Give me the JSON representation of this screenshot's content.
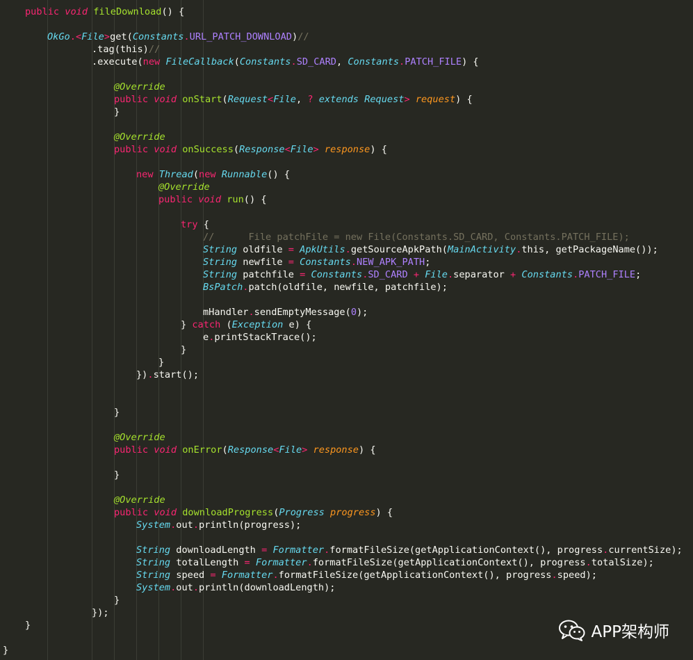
{
  "editor": {
    "theme": "monokai",
    "colors": {
      "background": "#272822",
      "keyword": "#f92672",
      "type": "#66d9ef",
      "function": "#a6e22e",
      "constant": "#ae81ff",
      "parameter": "#fd971f",
      "comment": "#75715e",
      "plain": "#f8f8f2"
    },
    "lines": [
      {
        "indent": 1,
        "tokens": [
          [
            "kw",
            "public"
          ],
          [
            "pl",
            " "
          ],
          [
            "kwi",
            "void"
          ],
          [
            "pl",
            " "
          ],
          [
            "fn",
            "fileDownload"
          ],
          [
            "pl",
            "() {"
          ]
        ]
      },
      {
        "indent": 0,
        "tokens": []
      },
      {
        "indent": 2,
        "tokens": [
          [
            "ty",
            "OkGo"
          ],
          [
            "kw",
            "."
          ],
          [
            "kw",
            "<"
          ],
          [
            "ty",
            "File"
          ],
          [
            "kw",
            ">"
          ],
          [
            "pl",
            "get("
          ],
          [
            "ty",
            "Constants"
          ],
          [
            "kw",
            "."
          ],
          [
            "cst",
            "URL_PATCH_DOWNLOAD"
          ],
          [
            "pl",
            ")"
          ],
          [
            "cmt",
            "//"
          ]
        ]
      },
      {
        "indent": 4,
        "tokens": [
          [
            "pl",
            ".tag(this)"
          ],
          [
            "cmt",
            "//"
          ]
        ]
      },
      {
        "indent": 4,
        "tokens": [
          [
            "pl",
            ".execute("
          ],
          [
            "kw",
            "new"
          ],
          [
            "pl",
            " "
          ],
          [
            "ty",
            "FileCallback"
          ],
          [
            "pl",
            "("
          ],
          [
            "ty",
            "Constants"
          ],
          [
            "kw",
            "."
          ],
          [
            "cst",
            "SD_CARD"
          ],
          [
            "pl",
            ", "
          ],
          [
            "ty",
            "Constants"
          ],
          [
            "kw",
            "."
          ],
          [
            "cst",
            "PATCH_FILE"
          ],
          [
            "pl",
            ") {"
          ]
        ]
      },
      {
        "indent": 0,
        "tokens": []
      },
      {
        "indent": 5,
        "tokens": [
          [
            "ann",
            "@Override"
          ]
        ]
      },
      {
        "indent": 5,
        "tokens": [
          [
            "kw",
            "public"
          ],
          [
            "pl",
            " "
          ],
          [
            "kwi",
            "void"
          ],
          [
            "pl",
            " "
          ],
          [
            "fn",
            "onStart"
          ],
          [
            "pl",
            "("
          ],
          [
            "ty",
            "Request"
          ],
          [
            "kw",
            "<"
          ],
          [
            "ty",
            "File"
          ],
          [
            "pl",
            ", "
          ],
          [
            "kw",
            "?"
          ],
          [
            "pl",
            " "
          ],
          [
            "ty",
            "extends"
          ],
          [
            "pl",
            " "
          ],
          [
            "ty",
            "Request"
          ],
          [
            "kw",
            ">"
          ],
          [
            "pl",
            " "
          ],
          [
            "par",
            "request"
          ],
          [
            "pl",
            ") {"
          ]
        ]
      },
      {
        "indent": 5,
        "tokens": [
          [
            "pl",
            "}"
          ]
        ]
      },
      {
        "indent": 0,
        "tokens": []
      },
      {
        "indent": 5,
        "tokens": [
          [
            "ann",
            "@Override"
          ]
        ]
      },
      {
        "indent": 5,
        "tokens": [
          [
            "kw",
            "public"
          ],
          [
            "pl",
            " "
          ],
          [
            "kwi",
            "void"
          ],
          [
            "pl",
            " "
          ],
          [
            "fn",
            "onSuccess"
          ],
          [
            "pl",
            "("
          ],
          [
            "ty",
            "Response"
          ],
          [
            "kw",
            "<"
          ],
          [
            "ty",
            "File"
          ],
          [
            "kw",
            ">"
          ],
          [
            "pl",
            " "
          ],
          [
            "par",
            "response"
          ],
          [
            "pl",
            ") {"
          ]
        ]
      },
      {
        "indent": 0,
        "tokens": []
      },
      {
        "indent": 6,
        "tokens": [
          [
            "kw",
            "new"
          ],
          [
            "pl",
            " "
          ],
          [
            "ty",
            "Thread"
          ],
          [
            "pl",
            "("
          ],
          [
            "kw",
            "new"
          ],
          [
            "pl",
            " "
          ],
          [
            "ty",
            "Runnable"
          ],
          [
            "pl",
            "() {"
          ]
        ]
      },
      {
        "indent": 7,
        "tokens": [
          [
            "ann",
            "@Override"
          ]
        ]
      },
      {
        "indent": 7,
        "tokens": [
          [
            "kw",
            "public"
          ],
          [
            "pl",
            " "
          ],
          [
            "kwi",
            "void"
          ],
          [
            "pl",
            " "
          ],
          [
            "fn",
            "run"
          ],
          [
            "pl",
            "() {"
          ]
        ]
      },
      {
        "indent": 0,
        "tokens": []
      },
      {
        "indent": 8,
        "tokens": [
          [
            "kw",
            "try"
          ],
          [
            "pl",
            " {"
          ]
        ]
      },
      {
        "indent": 9,
        "tokens": [
          [
            "cmt",
            "//      File patchFile = new File(Constants.SD_CARD, Constants.PATCH_FILE);"
          ]
        ]
      },
      {
        "indent": 9,
        "tokens": [
          [
            "ty",
            "String"
          ],
          [
            "pl",
            " oldfile "
          ],
          [
            "kw",
            "="
          ],
          [
            "pl",
            " "
          ],
          [
            "ty",
            "ApkUtils"
          ],
          [
            "kw",
            "."
          ],
          [
            "pl",
            "getSourceApkPath("
          ],
          [
            "ty",
            "MainActivity"
          ],
          [
            "kw",
            "."
          ],
          [
            "pl",
            "this, getPackageName());"
          ]
        ]
      },
      {
        "indent": 9,
        "tokens": [
          [
            "ty",
            "String"
          ],
          [
            "pl",
            " newfile "
          ],
          [
            "kw",
            "="
          ],
          [
            "pl",
            " "
          ],
          [
            "ty",
            "Constants"
          ],
          [
            "kw",
            "."
          ],
          [
            "cst",
            "NEW_APK_PATH"
          ],
          [
            "pl",
            ";"
          ]
        ]
      },
      {
        "indent": 9,
        "tokens": [
          [
            "ty",
            "String"
          ],
          [
            "pl",
            " patchfile "
          ],
          [
            "kw",
            "="
          ],
          [
            "pl",
            " "
          ],
          [
            "ty",
            "Constants"
          ],
          [
            "kw",
            "."
          ],
          [
            "cst",
            "SD_CARD"
          ],
          [
            "pl",
            " "
          ],
          [
            "kw",
            "+"
          ],
          [
            "pl",
            " "
          ],
          [
            "ty",
            "File"
          ],
          [
            "kw",
            "."
          ],
          [
            "pl",
            "separator "
          ],
          [
            "kw",
            "+"
          ],
          [
            "pl",
            " "
          ],
          [
            "ty",
            "Constants"
          ],
          [
            "kw",
            "."
          ],
          [
            "cst",
            "PATCH_FILE"
          ],
          [
            "pl",
            ";"
          ]
        ]
      },
      {
        "indent": 9,
        "tokens": [
          [
            "ty",
            "BsPatch"
          ],
          [
            "kw",
            "."
          ],
          [
            "pl",
            "patch(oldfile, newfile, patchfile);"
          ]
        ]
      },
      {
        "indent": 0,
        "tokens": []
      },
      {
        "indent": 9,
        "tokens": [
          [
            "pl",
            "mHandler"
          ],
          [
            "kw",
            "."
          ],
          [
            "pl",
            "sendEmptyMessage("
          ],
          [
            "num",
            "0"
          ],
          [
            "pl",
            ");"
          ]
        ]
      },
      {
        "indent": 8,
        "tokens": [
          [
            "pl",
            "} "
          ],
          [
            "kw",
            "catch"
          ],
          [
            "pl",
            " ("
          ],
          [
            "ty",
            "Exception"
          ],
          [
            "pl",
            " e) {"
          ]
        ]
      },
      {
        "indent": 9,
        "tokens": [
          [
            "pl",
            "e"
          ],
          [
            "kw",
            "."
          ],
          [
            "pl",
            "printStackTrace();"
          ]
        ]
      },
      {
        "indent": 8,
        "tokens": [
          [
            "pl",
            "}"
          ]
        ]
      },
      {
        "indent": 7,
        "tokens": [
          [
            "pl",
            "}"
          ]
        ]
      },
      {
        "indent": 6,
        "tokens": [
          [
            "pl",
            "})"
          ],
          [
            "kw",
            "."
          ],
          [
            "pl",
            "start();"
          ]
        ]
      },
      {
        "indent": 0,
        "tokens": []
      },
      {
        "indent": 0,
        "tokens": []
      },
      {
        "indent": 5,
        "tokens": [
          [
            "pl",
            "}"
          ]
        ]
      },
      {
        "indent": 0,
        "tokens": []
      },
      {
        "indent": 5,
        "tokens": [
          [
            "ann",
            "@Override"
          ]
        ]
      },
      {
        "indent": 5,
        "tokens": [
          [
            "kw",
            "public"
          ],
          [
            "pl",
            " "
          ],
          [
            "kwi",
            "void"
          ],
          [
            "pl",
            " "
          ],
          [
            "fn",
            "onError"
          ],
          [
            "pl",
            "("
          ],
          [
            "ty",
            "Response"
          ],
          [
            "kw",
            "<"
          ],
          [
            "ty",
            "File"
          ],
          [
            "kw",
            ">"
          ],
          [
            "pl",
            " "
          ],
          [
            "par",
            "response"
          ],
          [
            "pl",
            ") {"
          ]
        ]
      },
      {
        "indent": 0,
        "tokens": []
      },
      {
        "indent": 5,
        "tokens": [
          [
            "pl",
            "}"
          ]
        ]
      },
      {
        "indent": 0,
        "tokens": []
      },
      {
        "indent": 5,
        "tokens": [
          [
            "ann",
            "@Override"
          ]
        ]
      },
      {
        "indent": 5,
        "tokens": [
          [
            "kw",
            "public"
          ],
          [
            "pl",
            " "
          ],
          [
            "kwi",
            "void"
          ],
          [
            "pl",
            " "
          ],
          [
            "fn",
            "downloadProgress"
          ],
          [
            "pl",
            "("
          ],
          [
            "ty",
            "Progress"
          ],
          [
            "pl",
            " "
          ],
          [
            "par",
            "progress"
          ],
          [
            "pl",
            ") {"
          ]
        ]
      },
      {
        "indent": 6,
        "tokens": [
          [
            "ty",
            "System"
          ],
          [
            "kw",
            "."
          ],
          [
            "pl",
            "out"
          ],
          [
            "kw",
            "."
          ],
          [
            "pl",
            "println(progress);"
          ]
        ]
      },
      {
        "indent": 0,
        "tokens": []
      },
      {
        "indent": 6,
        "tokens": [
          [
            "ty",
            "String"
          ],
          [
            "pl",
            " downloadLength "
          ],
          [
            "kw",
            "="
          ],
          [
            "pl",
            " "
          ],
          [
            "ty",
            "Formatter"
          ],
          [
            "kw",
            "."
          ],
          [
            "pl",
            "formatFileSize(getApplicationContext(), progress"
          ],
          [
            "kw",
            "."
          ],
          [
            "pl",
            "currentSize);"
          ]
        ]
      },
      {
        "indent": 6,
        "tokens": [
          [
            "ty",
            "String"
          ],
          [
            "pl",
            " totalLength "
          ],
          [
            "kw",
            "="
          ],
          [
            "pl",
            " "
          ],
          [
            "ty",
            "Formatter"
          ],
          [
            "kw",
            "."
          ],
          [
            "pl",
            "formatFileSize(getApplicationContext(), progress"
          ],
          [
            "kw",
            "."
          ],
          [
            "pl",
            "totalSize);"
          ]
        ]
      },
      {
        "indent": 6,
        "tokens": [
          [
            "ty",
            "String"
          ],
          [
            "pl",
            " speed "
          ],
          [
            "kw",
            "="
          ],
          [
            "pl",
            " "
          ],
          [
            "ty",
            "Formatter"
          ],
          [
            "kw",
            "."
          ],
          [
            "pl",
            "formatFileSize(getApplicationContext(), progress"
          ],
          [
            "kw",
            "."
          ],
          [
            "pl",
            "speed);"
          ]
        ]
      },
      {
        "indent": 6,
        "tokens": [
          [
            "ty",
            "System"
          ],
          [
            "kw",
            "."
          ],
          [
            "pl",
            "out"
          ],
          [
            "kw",
            "."
          ],
          [
            "pl",
            "println(downloadLength);"
          ]
        ]
      },
      {
        "indent": 5,
        "tokens": [
          [
            "pl",
            "}"
          ]
        ]
      },
      {
        "indent": 4,
        "tokens": [
          [
            "pl",
            "});"
          ]
        ]
      },
      {
        "indent": 1,
        "tokens": [
          [
            "pl",
            "}"
          ]
        ]
      },
      {
        "indent": 0,
        "tokens": []
      },
      {
        "indent": 0,
        "tokens": [
          [
            "pl",
            "}"
          ]
        ]
      }
    ]
  },
  "watermark": {
    "icon": "wechat-icon",
    "text": "APP架构师"
  }
}
